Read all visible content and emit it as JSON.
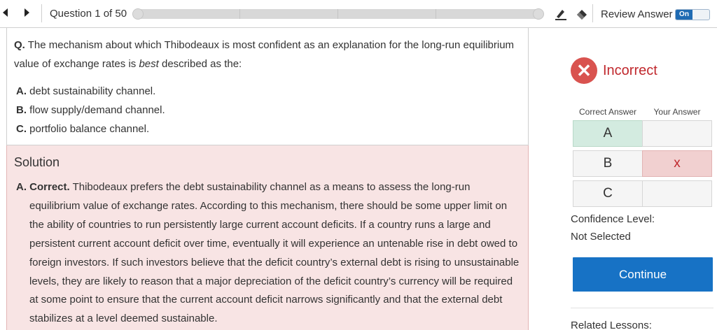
{
  "topbar": {
    "question_counter": "Question 1 of 50",
    "progress": {
      "current": 1,
      "total": 50
    },
    "review_label": "Review Answer",
    "review_toggle": "On",
    "icons": [
      "prev-arrow-icon",
      "next-arrow-icon",
      "highlighter-icon",
      "eraser-icon"
    ]
  },
  "question": {
    "prefix": "Q.",
    "text_before_em": "The mechanism about which Thibodeaux is most confident as an explanation for the long-run equilibrium value of exchange rates is ",
    "emphasis": "best",
    "text_after_em": " described as the:",
    "options": [
      {
        "letter": "A.",
        "text": "debt sustainability channel."
      },
      {
        "letter": "B.",
        "text": "flow supply/demand channel."
      },
      {
        "letter": "C.",
        "text": "portfolio balance channel."
      }
    ]
  },
  "solution": {
    "title": "Solution",
    "prefix": "A. Correct.",
    "text": "Thibodeaux prefers the debt sustainability channel as a means to assess the long-run equilibrium value of exchange rates. According to this mechanism, there should be some upper limit on the ability of countries to run persistently large current account deficits. If a country runs a large and persistent current account deficit over time, eventually it will experience an untenable rise in debt owed to foreign investors. If such investors believe that the deficit country’s external debt is rising to unsustainable levels, they are likely to reason that a major depreciation of the deficit country’s currency will be required at some point to ensure that the current account deficit narrows significantly and that the external debt stabilizes at a level deemed sustainable."
  },
  "result": {
    "status": "Incorrect",
    "icon": "x-circle-icon",
    "status_color": "#c0282d",
    "correct_answer_header": "Correct Answer",
    "your_answer_header": "Your Answer",
    "rows": [
      {
        "letter": "A",
        "correct": true,
        "your_mark": ""
      },
      {
        "letter": "B",
        "correct": false,
        "your_mark": "x"
      },
      {
        "letter": "C",
        "correct": false,
        "your_mark": ""
      }
    ],
    "confidence_label": "Confidence Level:",
    "confidence_value": "Not Selected",
    "continue_label": "Continue",
    "continue_color": "#1772c5",
    "related_label": "Related Lessons:"
  }
}
